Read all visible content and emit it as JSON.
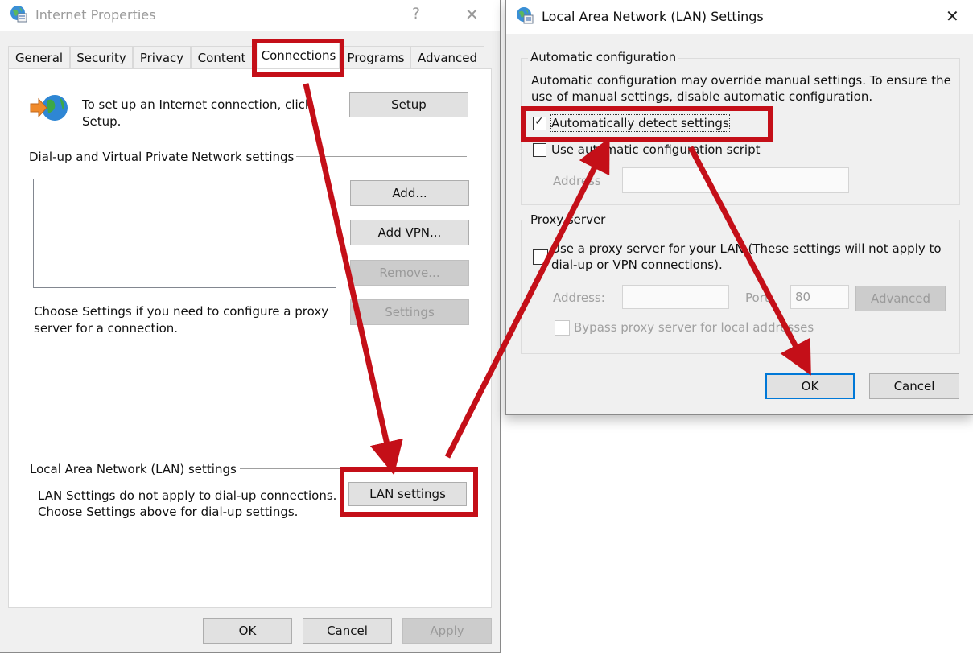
{
  "internet_properties": {
    "title": "Internet Properties",
    "help_glyph": "?",
    "close_glyph": "✕",
    "icon": "internet-options-globe-icon",
    "tabs": [
      {
        "label": "General",
        "active": false
      },
      {
        "label": "Security",
        "active": false
      },
      {
        "label": "Privacy",
        "active": false
      },
      {
        "label": "Content",
        "active": false
      },
      {
        "label": "Connections",
        "active": true
      },
      {
        "label": "Programs",
        "active": false
      },
      {
        "label": "Advanced",
        "active": false
      }
    ],
    "setup_text": "To set up an Internet connection, click Setup.",
    "setup_text_line1": "To set up an Internet connection, click",
    "setup_text_line2": "Setup.",
    "setup_button": "Setup",
    "dialup_section_title": "Dial-up and Virtual Private Network settings",
    "dialup_buttons": {
      "add": "Add...",
      "add_vpn": "Add VPN...",
      "remove": "Remove...",
      "settings": "Settings"
    },
    "proxy_hint_line1": "Choose Settings if you need to configure a proxy",
    "proxy_hint_line2": "server for a connection.",
    "lan_section_title": "Local Area Network (LAN) settings",
    "lan_hint_line1": "LAN Settings do not apply to dial-up connections.",
    "lan_hint_line2": "Choose Settings above for dial-up settings.",
    "lan_settings_button": "LAN settings",
    "footer": {
      "ok": "OK",
      "cancel": "Cancel",
      "apply": "Apply"
    }
  },
  "lan_dialog": {
    "title": "Local Area Network (LAN) Settings",
    "close_glyph": "✕",
    "auto_config": {
      "title": "Automatic configuration",
      "desc_line1": "Automatic configuration may override manual settings.  To ensure the",
      "desc_line2": "use of manual settings, disable automatic configuration.",
      "auto_detect_label": "Automatically detect settings",
      "auto_detect_checked": true,
      "use_script_label": "Use automatic configuration script",
      "use_script_checked": false,
      "address_label": "Address",
      "address_value": ""
    },
    "proxy": {
      "title": "Proxy server",
      "use_proxy_line1": "Use a proxy server for your LAN (These settings will not apply to",
      "use_proxy_line2": "dial-up or VPN connections).",
      "use_proxy_checked": false,
      "address_label": "Address:",
      "address_value": "",
      "port_label": "Port:",
      "port_value": "80",
      "advanced_button": "Advanced",
      "bypass_label": "Bypass proxy server for local addresses",
      "bypass_checked": false
    },
    "ok": "OK",
    "cancel": "Cancel"
  },
  "annotations": {
    "highlight_color": "#c40f18",
    "check_glyph": "✓"
  }
}
